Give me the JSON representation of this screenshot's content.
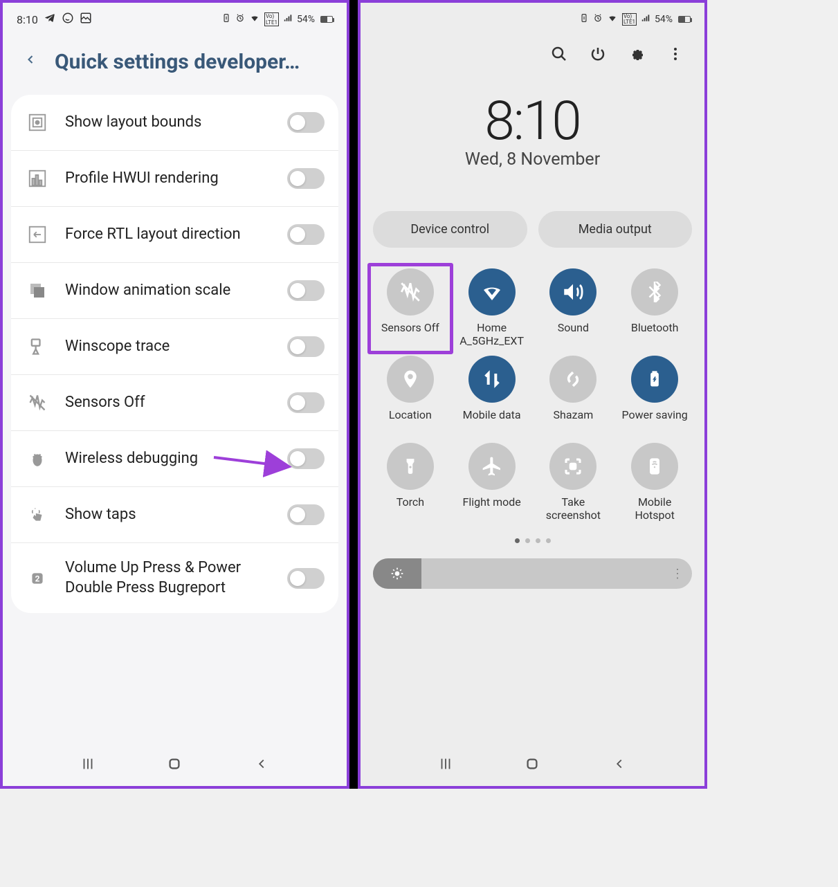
{
  "left": {
    "status": {
      "time": "8:10",
      "battery": "54%"
    },
    "title": "Quick settings developer…",
    "items": [
      {
        "label": "Show layout bounds"
      },
      {
        "label": "Profile HWUI rendering"
      },
      {
        "label": "Force RTL layout direction"
      },
      {
        "label": "Window animation scale"
      },
      {
        "label": "Winscope trace"
      },
      {
        "label": "Sensors Off"
      },
      {
        "label": "Wireless debugging"
      },
      {
        "label": "Show taps"
      },
      {
        "label": "Volume Up Press & Power Double Press Bugreport"
      }
    ]
  },
  "right": {
    "status": {
      "battery": "54%"
    },
    "clock": "8:10",
    "date": "Wed, 8 November",
    "pills": {
      "device": "Device control",
      "media": "Media output"
    },
    "tiles": [
      {
        "label": "Sensors Off",
        "on": false,
        "highlight": true
      },
      {
        "label": "Home A_5GHz_EXT",
        "on": true
      },
      {
        "label": "Sound",
        "on": true
      },
      {
        "label": "Bluetooth",
        "on": false
      },
      {
        "label": "Location",
        "on": false
      },
      {
        "label": "Mobile data",
        "on": true
      },
      {
        "label": "Shazam",
        "on": false
      },
      {
        "label": "Power saving",
        "on": true
      },
      {
        "label": "Torch",
        "on": false
      },
      {
        "label": "Flight mode",
        "on": false
      },
      {
        "label": "Take screenshot",
        "on": false
      },
      {
        "label": "Mobile Hotspot",
        "on": false
      }
    ]
  }
}
